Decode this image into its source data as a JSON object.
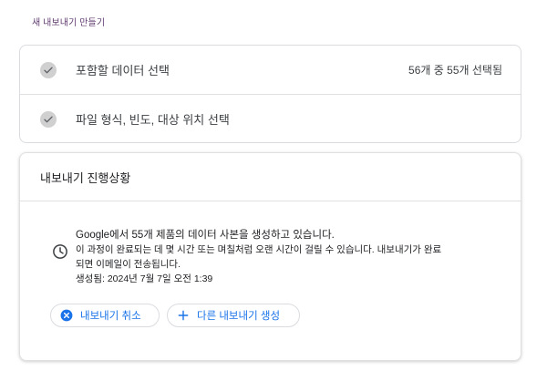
{
  "page": {
    "title": "새 내보내기 만들기"
  },
  "steps": [
    {
      "label": "포함할 데이터 선택",
      "count": "56개 중 55개 선택됨"
    },
    {
      "label": "파일 형식, 빈도, 대상 위치 선택"
    }
  ],
  "progress": {
    "title": "내보내기 진행상황",
    "icon": "clock-icon",
    "headline": "Google에서 55개 제품의 데이터 사본을 생성하고 있습니다.",
    "line2": "이 과정이 완료되는 데 몇 시간 또는 며칠처럼 오랜 시간이 걸릴 수 있습니다. 내보내기가 완료",
    "line3": "되면 이메일이 전송됩니다.",
    "created": "생성됨: 2024년 7월 7일 오전 1:39",
    "cancel_label": "내보내기 취소",
    "create_label": "다른 내보내기 생성"
  },
  "colors": {
    "accent": "#1a73e8",
    "check_bg": "#d0d0d0",
    "border": "#dadce0"
  }
}
